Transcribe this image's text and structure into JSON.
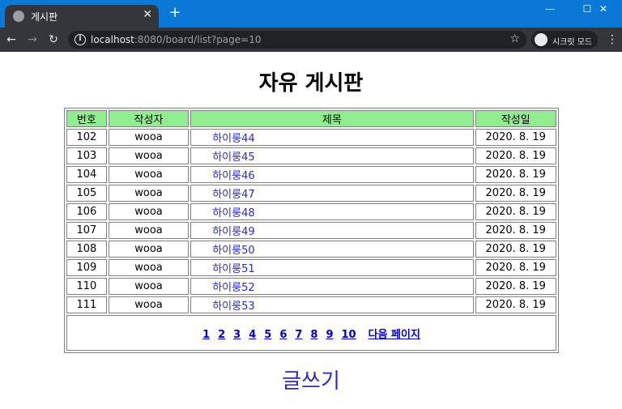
{
  "browser": {
    "tab_title": "게시판",
    "tab_close": "✕",
    "new_tab": "+",
    "url_host": "localhost",
    "url_rest": ":8080/board/list?page=10",
    "incognito_label": "시크릿 모드",
    "min": "—",
    "max": "☐",
    "close": "✕"
  },
  "page": {
    "title": "자유 게시판",
    "headers": [
      "번호",
      "작성자",
      "제목",
      "작성일"
    ],
    "rows": [
      {
        "no": "102",
        "writer": "wooa",
        "title": "하이룽44",
        "date": "2020. 8. 19"
      },
      {
        "no": "103",
        "writer": "wooa",
        "title": "하이룽45",
        "date": "2020. 8. 19"
      },
      {
        "no": "104",
        "writer": "wooa",
        "title": "하이룽46",
        "date": "2020. 8. 19"
      },
      {
        "no": "105",
        "writer": "wooa",
        "title": "하이룽47",
        "date": "2020. 8. 19"
      },
      {
        "no": "106",
        "writer": "wooa",
        "title": "하이룽48",
        "date": "2020. 8. 19"
      },
      {
        "no": "107",
        "writer": "wooa",
        "title": "하이룽49",
        "date": "2020. 8. 19"
      },
      {
        "no": "108",
        "writer": "wooa",
        "title": "하이룽50",
        "date": "2020. 8. 19"
      },
      {
        "no": "109",
        "writer": "wooa",
        "title": "하이룽51",
        "date": "2020. 8. 19"
      },
      {
        "no": "110",
        "writer": "wooa",
        "title": "하이룽52",
        "date": "2020. 8. 19"
      },
      {
        "no": "111",
        "writer": "wooa",
        "title": "하이룽53",
        "date": "2020. 8. 19"
      }
    ],
    "pages": [
      "1",
      "2",
      "3",
      "4",
      "5",
      "6",
      "7",
      "8",
      "9",
      "10"
    ],
    "next_page": "다음 페이지",
    "write_link": "글쓰기"
  },
  "colors": {
    "header_bg": "#90ee90",
    "link": "#2a2acc",
    "titlebar": "#0a78d7"
  }
}
